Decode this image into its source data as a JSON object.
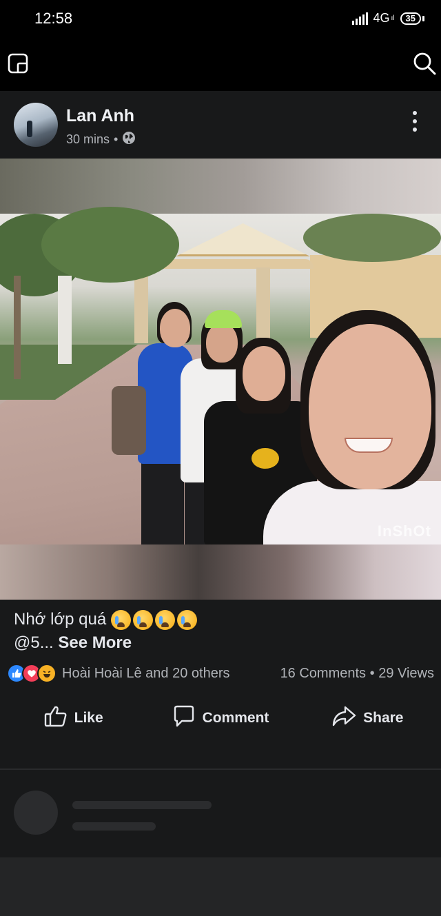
{
  "status_bar": {
    "time": "12:58",
    "network": "4G",
    "network_sub": "ıl",
    "battery": "35"
  },
  "top_bar": {
    "left_icon": "story-square-icon",
    "right_icon": "search-icon"
  },
  "post": {
    "author": "Lan Anh",
    "time": "30 mins",
    "separator": "•",
    "privacy_icon": "globe-icon",
    "watermark": "InShOt",
    "caption_text": "Nhớ lớp quá",
    "caption_emojis": [
      "loudly-crying-face",
      "loudly-crying-face",
      "loudly-crying-face",
      "loudly-crying-face"
    ],
    "caption_second_line": "@5...",
    "see_more": "See More",
    "reaction_names": "Hoài Hoài Lê and 20 others",
    "comments": "16 Comments",
    "stats_separator": "•",
    "views": "29 Views",
    "actions": {
      "like": "Like",
      "comment": "Comment",
      "share": "Share"
    }
  },
  "colors": {
    "background": "#18191a",
    "text": "#e4e6eb",
    "secondary_text": "#b0b3b8",
    "like_blue": "#2d88ff",
    "love_red": "#f33e58",
    "haha_yellow": "#f7b125"
  }
}
